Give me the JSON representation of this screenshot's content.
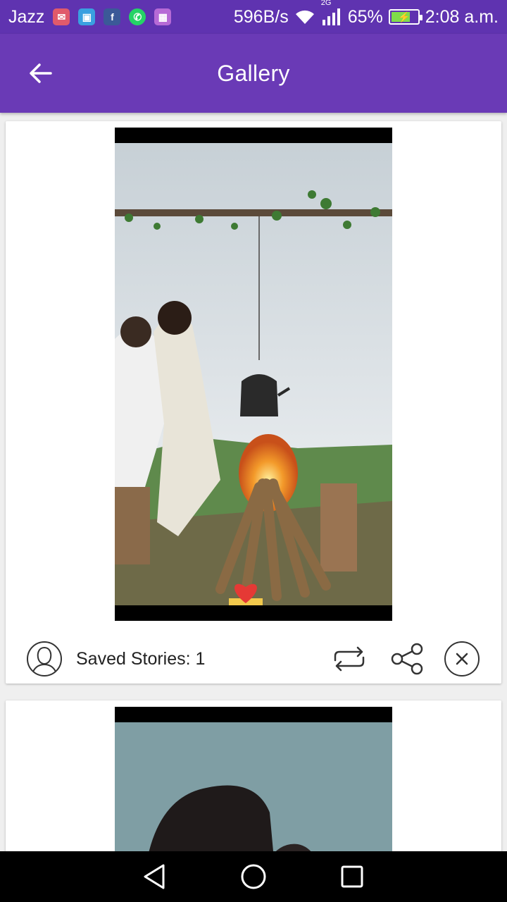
{
  "status_bar": {
    "carrier": "Jazz",
    "network_speed": "596B/s",
    "network_type": "2G",
    "battery": "65%",
    "time": "2:08 a.m.",
    "notification_icons": [
      "mail-icon",
      "android-icon",
      "facebook-icon",
      "whatsapp-icon",
      "gallery-icon"
    ]
  },
  "app_bar": {
    "title": "Gallery"
  },
  "cards": [
    {
      "saved_label": "Saved Stories: 1",
      "media_type": "video-thumbnail"
    },
    {
      "media_type": "video-thumbnail"
    }
  ],
  "colors": {
    "primary": "#6a3ab6",
    "status_bar": "#5f33b0",
    "background": "#efefef"
  }
}
